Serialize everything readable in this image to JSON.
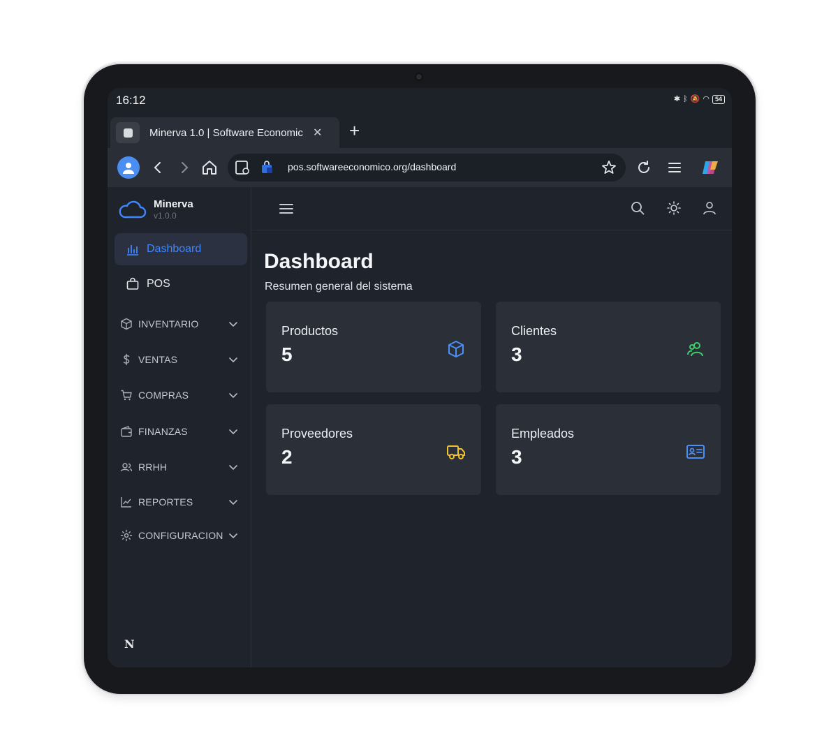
{
  "status_bar": {
    "time": "16:12",
    "battery": "54"
  },
  "browser": {
    "tab_title": "Minerva 1.0 | Software Economic",
    "url": "pos.softwareeconomico.org/dashboard"
  },
  "sidebar": {
    "brand_name": "Minerva",
    "brand_version": "v1.0.0",
    "active_item": "Dashboard",
    "pos_item": "POS",
    "groups": [
      {
        "label": "INVENTARIO",
        "icon": "box-icon"
      },
      {
        "label": "VENTAS",
        "icon": "dollar-icon"
      },
      {
        "label": "COMPRAS",
        "icon": "cart-icon"
      },
      {
        "label": "FINANZAS",
        "icon": "wallet-icon"
      },
      {
        "label": "RRHH",
        "icon": "people-icon"
      },
      {
        "label": "REPORTES",
        "icon": "line-chart-icon"
      },
      {
        "label": "CONFIGURACION",
        "icon": "gear-icon"
      }
    ],
    "footer_logo": "N"
  },
  "main": {
    "title": "Dashboard",
    "subtitle": "Resumen general del sistema",
    "cards": [
      {
        "label": "Productos",
        "value": "5",
        "icon": "cube-icon",
        "color": "#4a90f7"
      },
      {
        "label": "Clientes",
        "value": "3",
        "icon": "users-icon",
        "color": "#3fcf6a"
      },
      {
        "label": "Proveedores",
        "value": "2",
        "icon": "truck-icon",
        "color": "#f2c12e"
      },
      {
        "label": "Empleados",
        "value": "3",
        "icon": "id-card-icon",
        "color": "#4a90f7"
      }
    ]
  },
  "colors": {
    "accent": "#3f87ff",
    "background": "#1f232b",
    "card": "#2a2f38"
  }
}
